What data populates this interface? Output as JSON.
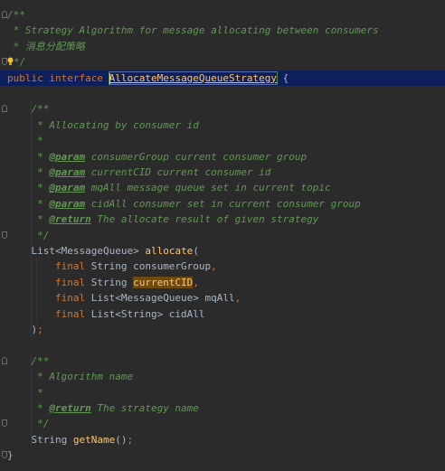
{
  "editor": {
    "lines": [
      {
        "id": "l1",
        "segments": [
          {
            "t": "/**",
            "c": "comment"
          }
        ]
      },
      {
        "id": "l2",
        "segments": [
          {
            "t": " * Strategy Algorithm for message allocating between consumers",
            "c": "comment"
          }
        ]
      },
      {
        "id": "l3",
        "segments": [
          {
            "t": " * ",
            "c": "comment"
          },
          {
            "t": "消息分配策略",
            "c": "comment cjk"
          }
        ]
      },
      {
        "id": "l4",
        "segments": [
          {
            "t": "*/",
            "c": "comment"
          }
        ]
      },
      {
        "id": "l5",
        "segments": [
          {
            "t": "public interface ",
            "c": "kw"
          },
          {
            "t": "AllocateMessageQueueStrategy",
            "c": "type-hl"
          },
          {
            "t": " {",
            "c": "ident"
          }
        ]
      },
      {
        "id": "l6",
        "segments": []
      },
      {
        "id": "l7",
        "segments": [
          {
            "t": "    /**",
            "c": "comment"
          }
        ]
      },
      {
        "id": "l8",
        "segments": [
          {
            "t": "     * Allocating by consumer id",
            "c": "comment"
          }
        ]
      },
      {
        "id": "l9",
        "segments": [
          {
            "t": "     *",
            "c": "comment"
          }
        ]
      },
      {
        "id": "l10",
        "segments": [
          {
            "t": "     * ",
            "c": "comment"
          },
          {
            "t": "@param",
            "c": "tag"
          },
          {
            "t": " consumerGroup current consumer group",
            "c": "comment"
          }
        ]
      },
      {
        "id": "l11",
        "segments": [
          {
            "t": "     * ",
            "c": "comment"
          },
          {
            "t": "@param",
            "c": "tag"
          },
          {
            "t": " currentCID current consumer id",
            "c": "comment"
          }
        ]
      },
      {
        "id": "l12",
        "segments": [
          {
            "t": "     * ",
            "c": "comment"
          },
          {
            "t": "@param",
            "c": "tag"
          },
          {
            "t": " mqAll message queue set in current topic",
            "c": "comment"
          }
        ]
      },
      {
        "id": "l13",
        "segments": [
          {
            "t": "     * ",
            "c": "comment"
          },
          {
            "t": "@param",
            "c": "tag"
          },
          {
            "t": " cidAll consumer set in current consumer group",
            "c": "comment"
          }
        ]
      },
      {
        "id": "l14",
        "segments": [
          {
            "t": "     * ",
            "c": "comment"
          },
          {
            "t": "@return",
            "c": "tag"
          },
          {
            "t": " The allocate result of given strategy",
            "c": "comment"
          }
        ]
      },
      {
        "id": "l15",
        "segments": [
          {
            "t": "     */",
            "c": "comment"
          }
        ]
      },
      {
        "id": "l16",
        "segments": [
          {
            "t": "    List<MessageQueue> ",
            "c": "ident"
          },
          {
            "t": "allocate",
            "c": "method"
          },
          {
            "t": "(",
            "c": "ident"
          }
        ]
      },
      {
        "id": "l17",
        "segments": [
          {
            "t": "        final ",
            "c": "kw"
          },
          {
            "t": "String consumerGroup",
            "c": "ident"
          },
          {
            "t": ",",
            "c": "kw"
          }
        ]
      },
      {
        "id": "l18",
        "segments": [
          {
            "t": "        final ",
            "c": "kw"
          },
          {
            "t": "String ",
            "c": "ident"
          },
          {
            "t": "currentCID",
            "c": "param-hl"
          },
          {
            "t": ",",
            "c": "kw"
          }
        ]
      },
      {
        "id": "l19",
        "segments": [
          {
            "t": "        final ",
            "c": "kw"
          },
          {
            "t": "List<MessageQueue> mqAll",
            "c": "ident"
          },
          {
            "t": ",",
            "c": "kw"
          }
        ]
      },
      {
        "id": "l20",
        "segments": [
          {
            "t": "        final ",
            "c": "kw"
          },
          {
            "t": "List<String> cidAll",
            "c": "ident"
          }
        ]
      },
      {
        "id": "l21",
        "segments": [
          {
            "t": "    )",
            "c": "ident"
          },
          {
            "t": ";",
            "c": "kw"
          }
        ]
      },
      {
        "id": "l22",
        "segments": []
      },
      {
        "id": "l23",
        "segments": [
          {
            "t": "    /**",
            "c": "comment"
          }
        ]
      },
      {
        "id": "l24",
        "segments": [
          {
            "t": "     * Algorithm name",
            "c": "comment"
          }
        ]
      },
      {
        "id": "l25",
        "segments": [
          {
            "t": "     *",
            "c": "comment"
          }
        ]
      },
      {
        "id": "l26",
        "segments": [
          {
            "t": "     * ",
            "c": "comment"
          },
          {
            "t": "@return",
            "c": "tag"
          },
          {
            "t": " The strategy name",
            "c": "comment"
          }
        ]
      },
      {
        "id": "l27",
        "segments": [
          {
            "t": "     */",
            "c": "comment"
          }
        ]
      },
      {
        "id": "l28",
        "segments": [
          {
            "t": "    String ",
            "c": "ident"
          },
          {
            "t": "getName",
            "c": "method"
          },
          {
            "t": "()",
            "c": "ident"
          },
          {
            "t": ";",
            "c": "kw"
          }
        ]
      },
      {
        "id": "l29",
        "segments": [
          {
            "t": "}",
            "c": "ident"
          }
        ]
      }
    ],
    "current_line": "l5",
    "colors": {
      "background": "#2b2b2b",
      "current_line": "#0d1f5c",
      "comment": "#629755",
      "keyword": "#cc7832",
      "method": "#ffc66d",
      "identifier": "#a9b7c6"
    },
    "icons": [
      "fold-marker-icon",
      "intention-bulb-icon"
    ]
  }
}
